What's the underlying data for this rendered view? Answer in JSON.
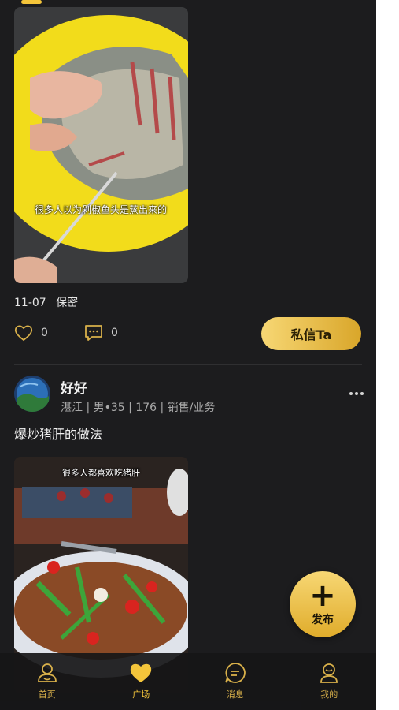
{
  "post1": {
    "caption": "很多人以为剁椒鱼头是蒸出来的",
    "date": "11-07",
    "privacy": "保密",
    "likes": "0",
    "comments": "0",
    "dm_label": "私信Ta"
  },
  "post2": {
    "username": "好好",
    "userinfo": "湛江 | 男•35 | 176 | 销售/业务",
    "title": "爆炒猪肝的做法",
    "caption": "很多人都喜欢吃猪肝"
  },
  "fab": {
    "label": "发布",
    "icon": "plus-icon"
  },
  "tabs": [
    {
      "label": "首页",
      "icon": "home-icon"
    },
    {
      "label": "广场",
      "icon": "heart-icon"
    },
    {
      "label": "消息",
      "icon": "message-icon"
    },
    {
      "label": "我的",
      "icon": "profile-icon"
    }
  ],
  "colors": {
    "accent": "#f4c53b",
    "background": "#1c1c1e"
  }
}
